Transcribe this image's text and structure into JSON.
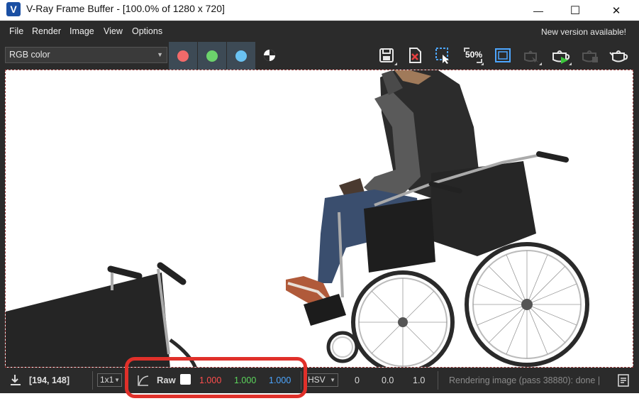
{
  "window": {
    "title": "V-Ray Frame Buffer - [100.0% of 1280 x 720]",
    "logo_letter": "V",
    "minimize_symbol": "—",
    "maximize_symbol": "☐",
    "close_symbol": "✕"
  },
  "menu": {
    "items": [
      {
        "label": "File"
      },
      {
        "label": "Render"
      },
      {
        "label": "Image"
      },
      {
        "label": "View"
      },
      {
        "label": "Options"
      }
    ],
    "notice": "New version available!"
  },
  "toolbar": {
    "channel_value": "RGB color",
    "channel_buttons": [
      {
        "name": "red-channel-button",
        "color": "#f26a6a"
      },
      {
        "name": "green-channel-button",
        "color": "#6cd36c"
      },
      {
        "name": "blue-channel-button",
        "color": "#6ac2f2"
      }
    ],
    "zoom_label": "50%",
    "icons": [
      "save-image-icon",
      "clear-image-icon",
      "region-render-icon",
      "zoom-50-icon",
      "render-frame-icon",
      "interactive-render-icon",
      "start-render-icon",
      "stop-render-icon",
      "render-teapot-icon"
    ]
  },
  "status": {
    "coords": "[194, 148]",
    "sample_size": "1x1",
    "color_mode": "Raw",
    "rgb": {
      "r": "1.000",
      "g": "1.000",
      "b": "1.000"
    },
    "hsv_mode": "HSV",
    "hsv_values": {
      "h": "0",
      "s": "0.0",
      "v": "1.0"
    },
    "render_status": "Rendering image (pass 38880): done |"
  },
  "colors": {
    "accent_blue": "#1a4fa3",
    "highlight_red": "#e0302a",
    "panel_bg": "#2b2b2b"
  }
}
